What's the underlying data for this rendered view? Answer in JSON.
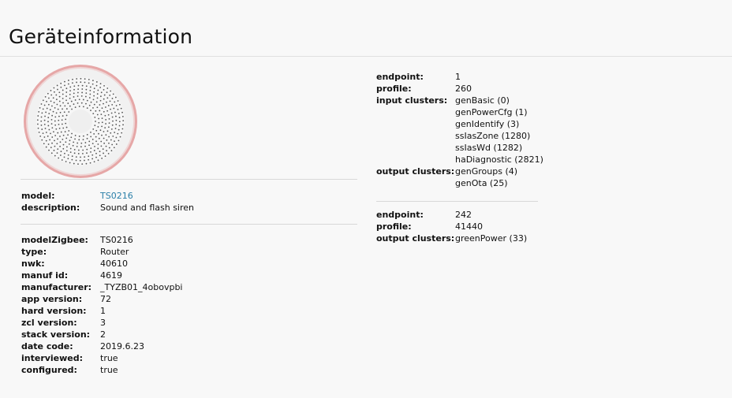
{
  "page_title": "Geräteinformation",
  "device": {
    "model_label": "model:",
    "model_value": "TS0216",
    "description_label": "description:",
    "description_value": "Sound and flash siren"
  },
  "details": [
    {
      "key": "modelZigbee:",
      "value": "TS0216"
    },
    {
      "key": "type:",
      "value": "Router"
    },
    {
      "key": "nwk:",
      "value": "40610"
    },
    {
      "key": "manuf id:",
      "value": "4619"
    },
    {
      "key": "manufacturer:",
      "value": "_TYZB01_4obovpbi"
    },
    {
      "key": "app version:",
      "value": "72"
    },
    {
      "key": "hard version:",
      "value": "1"
    },
    {
      "key": "zcl version:",
      "value": "3"
    },
    {
      "key": "stack version:",
      "value": "2"
    },
    {
      "key": "date code:",
      "value": "2019.6.23"
    },
    {
      "key": "interviewed:",
      "value": "true"
    },
    {
      "key": "configured:",
      "value": "true"
    }
  ],
  "endpoints": [
    {
      "endpoint_label": "endpoint:",
      "endpoint": "1",
      "profile_label": "profile:",
      "profile": "260",
      "input_label": "input clusters:",
      "input_clusters": [
        "genBasic (0)",
        "genPowerCfg (1)",
        "genIdentify (3)",
        "ssIasZone (1280)",
        "ssIasWd (1282)",
        "haDiagnostic (2821)"
      ],
      "output_label": "output clusters:",
      "output_clusters": [
        "genGroups (4)",
        "genOta (25)"
      ]
    },
    {
      "endpoint_label": "endpoint:",
      "endpoint": "242",
      "profile_label": "profile:",
      "profile": "41440",
      "output_label": "output clusters:",
      "output_clusters": [
        "greenPower (33)"
      ]
    }
  ],
  "colors": {
    "link": "#2a7fa8",
    "device_ring": "#e08a8a"
  },
  "image": {
    "icon": "siren-device-image"
  }
}
